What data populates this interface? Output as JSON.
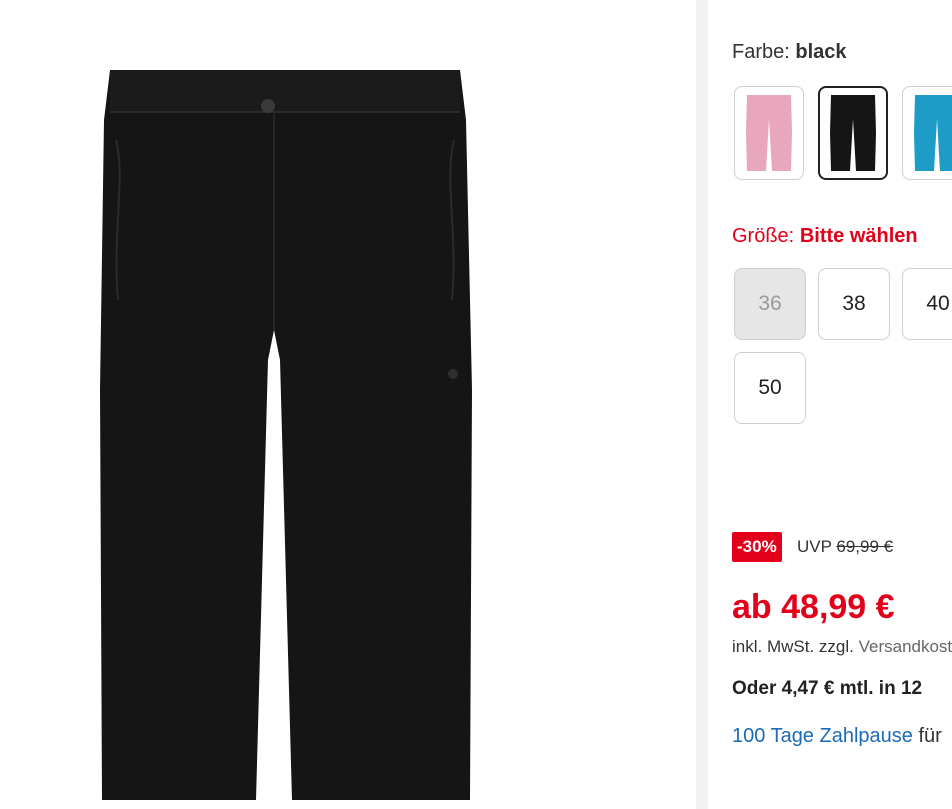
{
  "color": {
    "label": "Farbe:",
    "selected_value": "black",
    "swatches": [
      {
        "name": "pink",
        "color": "#e8a7bc"
      },
      {
        "name": "black",
        "color": "#151515"
      },
      {
        "name": "blue",
        "color": "#1d9cc7"
      }
    ]
  },
  "size": {
    "label": "Größe:",
    "prompt": "Bitte wählen",
    "options": [
      "36",
      "38",
      "40",
      "50"
    ],
    "disabled": [
      "36"
    ]
  },
  "pricing": {
    "discount_badge": "-30%",
    "uvp_label": "UVP",
    "uvp_price": "69,99 €",
    "price": "ab 48,99 €",
    "tax_text": "inkl. MwSt. zzgl.",
    "shipping_link": "Versandkosten",
    "installment": "Oder 4,47 € mtl. in 12",
    "payment_pause_link": "100 Tage Zahlpause",
    "payment_pause_suffix": "für"
  },
  "colors": {
    "accent_red": "#e2001a",
    "link_blue": "#1a6bb8"
  }
}
